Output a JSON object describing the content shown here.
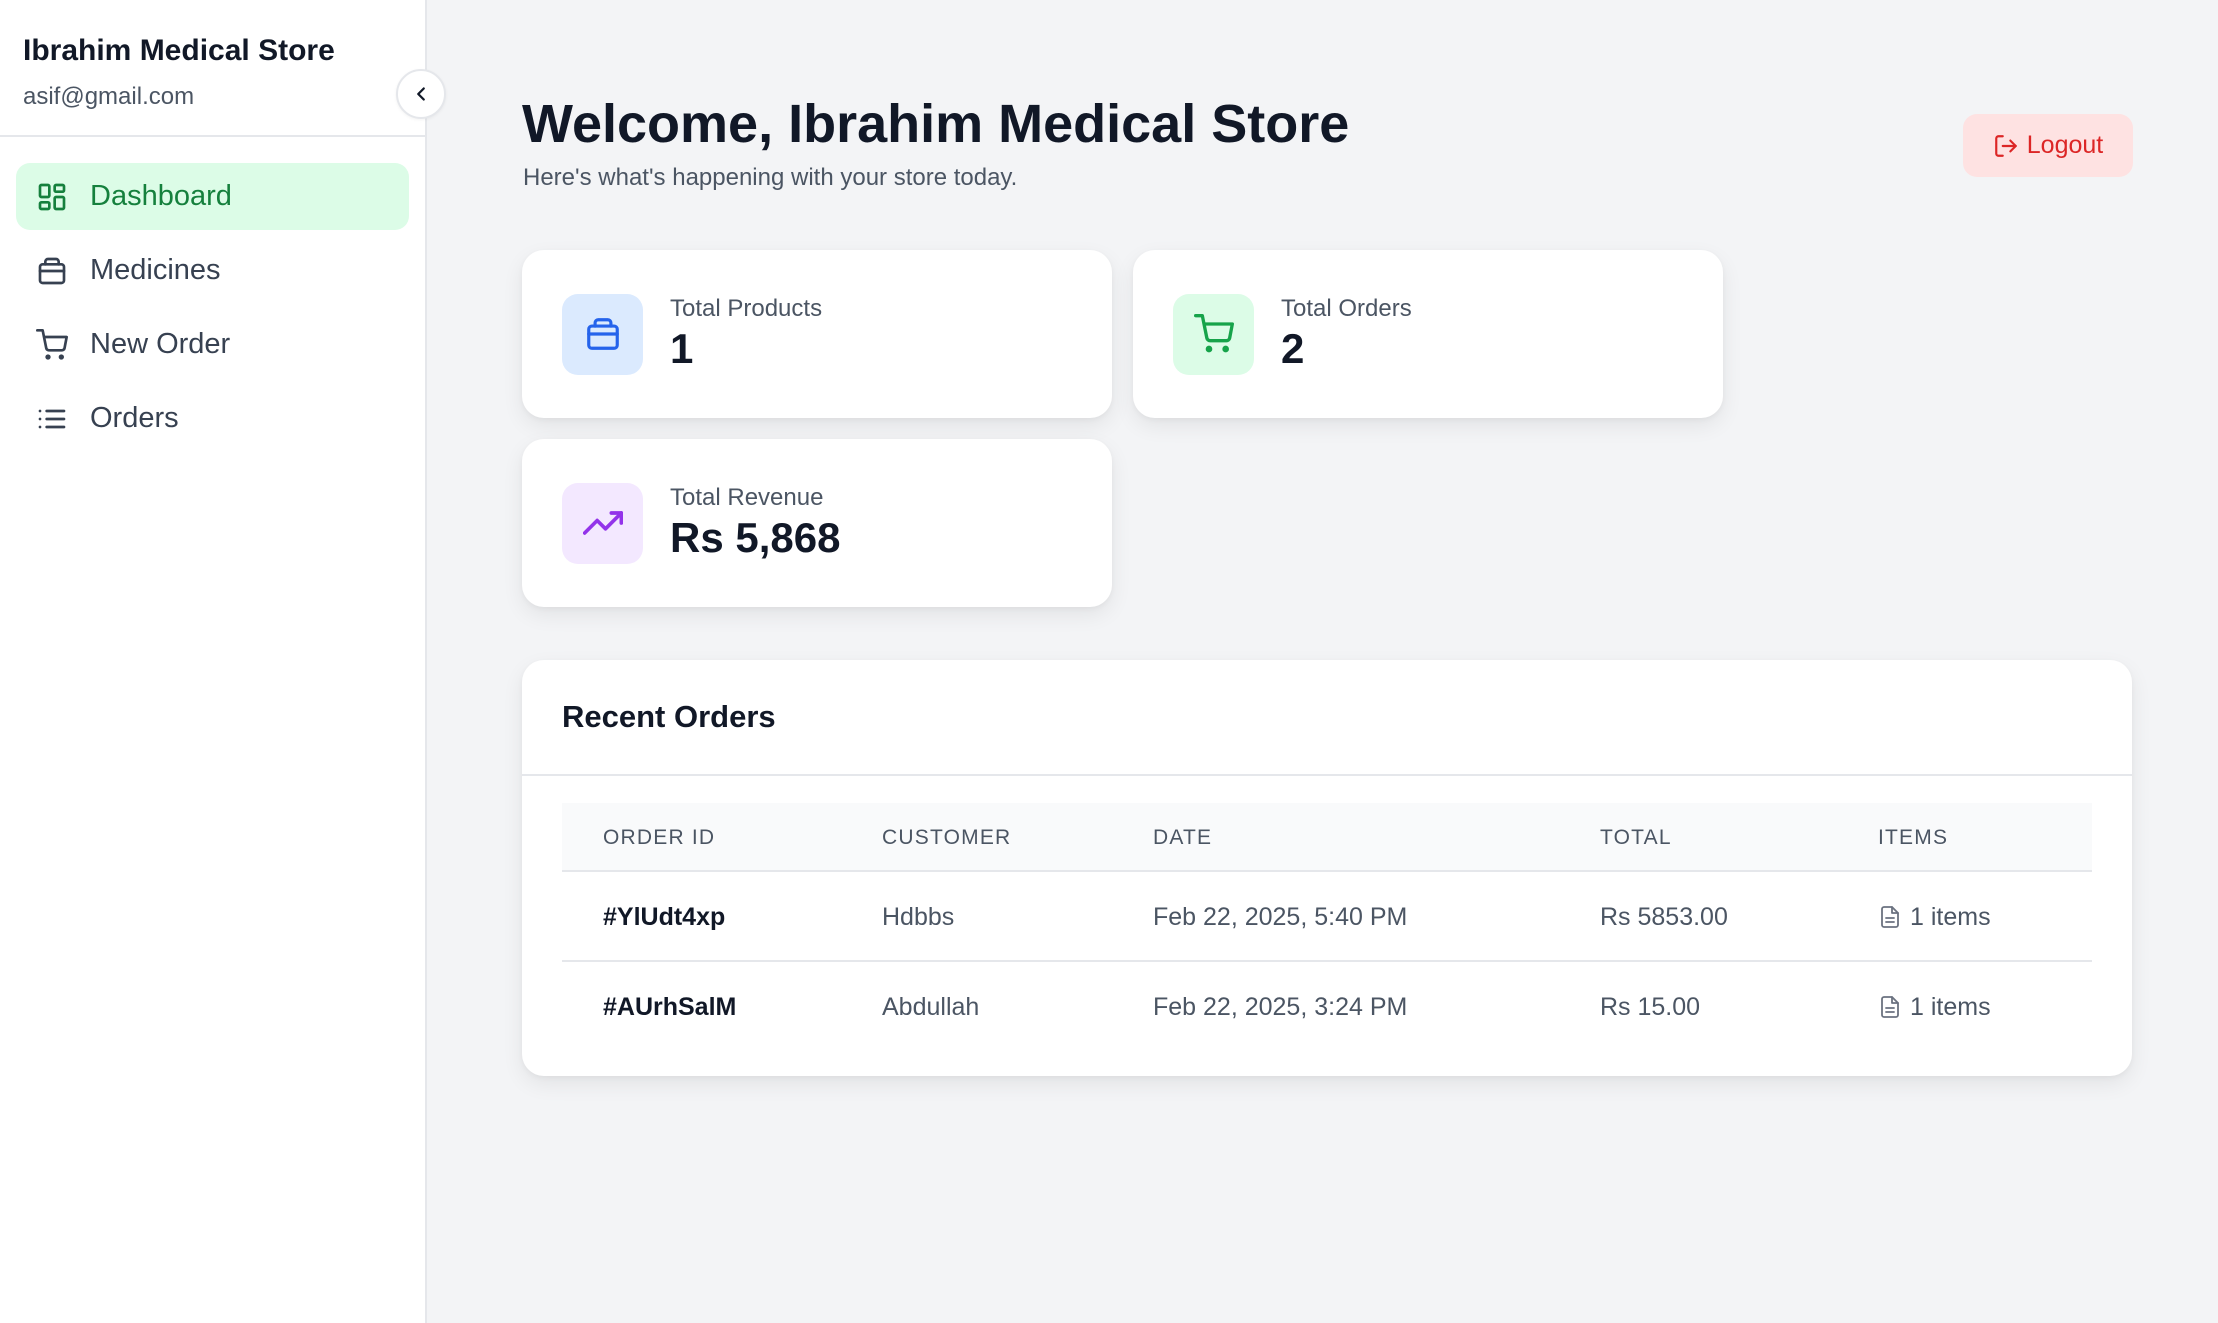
{
  "sidebar": {
    "store_name": "Ibrahim Medical Store",
    "email": "asif@gmail.com",
    "nav": [
      {
        "label": "Dashboard",
        "icon": "dashboard-grid-icon",
        "active": true
      },
      {
        "label": "Medicines",
        "icon": "package-icon",
        "active": false
      },
      {
        "label": "New Order",
        "icon": "cart-icon",
        "active": false
      },
      {
        "label": "Orders",
        "icon": "list-icon",
        "active": false
      }
    ]
  },
  "header": {
    "title": "Welcome, Ibrahim Medical Store",
    "subtitle": "Here's what's happening with your store today.",
    "logout_label": "Logout"
  },
  "stats": [
    {
      "label": "Total Products",
      "value": "1",
      "icon": "package-icon",
      "bg": "#dbeafe",
      "color": "#2563eb"
    },
    {
      "label": "Total Orders",
      "value": "2",
      "icon": "cart-icon",
      "bg": "#dcfce7",
      "color": "#16a34a"
    },
    {
      "label": "Total Revenue",
      "value": "Rs 5,868",
      "icon": "trending-up-icon",
      "bg": "#f3e8ff",
      "color": "#9333ea"
    }
  ],
  "recent_orders": {
    "title": "Recent Orders",
    "columns": [
      "ORDER ID",
      "CUSTOMER",
      "DATE",
      "TOTAL",
      "ITEMS"
    ],
    "rows": [
      {
        "id": "#YlUdt4xp",
        "customer": "Hdbbs",
        "date": "Feb 22, 2025, 5:40 PM",
        "total": "Rs 5853.00",
        "items": "1 items"
      },
      {
        "id": "#AUrhSalM",
        "customer": "Abdullah",
        "date": "Feb 22, 2025, 3:24 PM",
        "total": "Rs 15.00",
        "items": "1 items"
      }
    ]
  },
  "colors": {
    "accent_green": "#15803d",
    "active_bg": "#dcfce7",
    "logout_bg": "#fee2e2",
    "logout_text": "#dc2626"
  }
}
